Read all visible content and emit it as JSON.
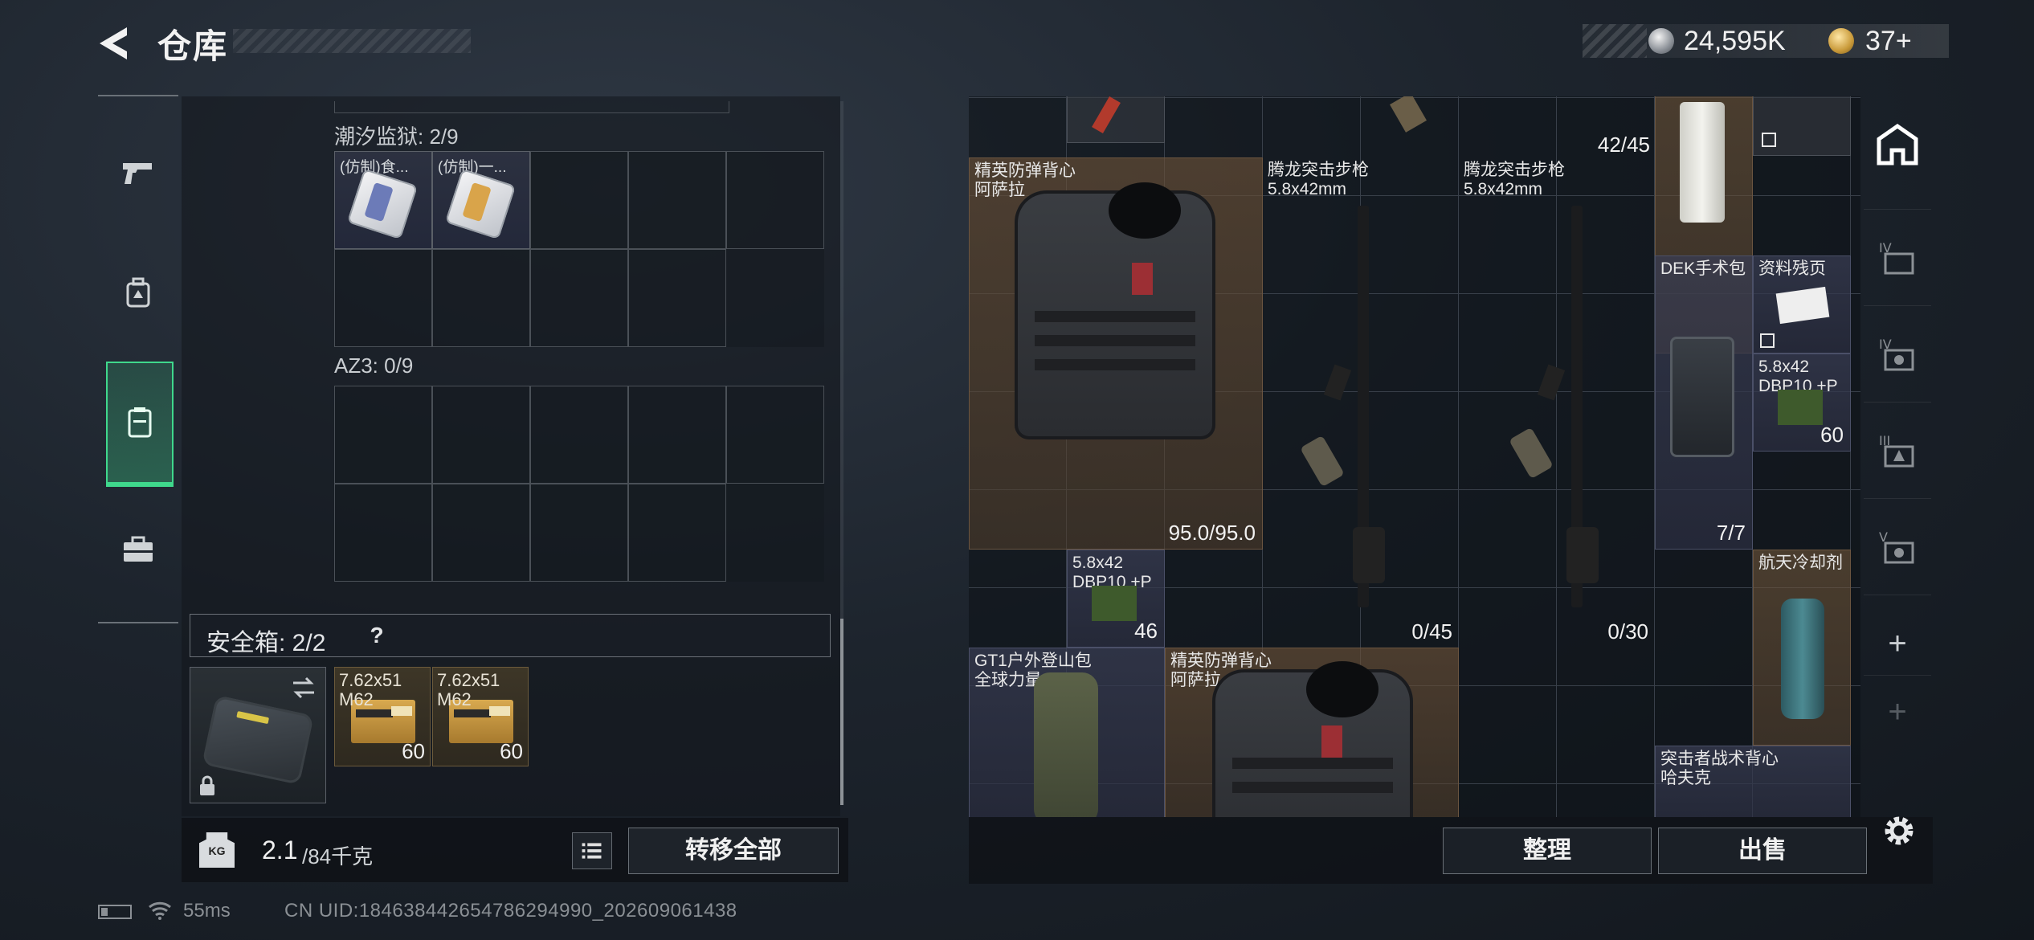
{
  "header": {
    "title": "仓库",
    "silver_amount": "24,595K",
    "gold_amount": "37+"
  },
  "left_panel": {
    "section_1_label": "潮汐监狱: 2/9",
    "section_1_items": [
      {
        "name": "(仿制)食...",
        "accent": "#6c7bb8"
      },
      {
        "name": "(仿制)一...",
        "accent": "#d9a44a"
      }
    ],
    "section_2_label": "AZ3: 0/9",
    "safe_box_label": "安全箱: 2/2",
    "safe_box_help": "?",
    "ammo": [
      {
        "name": "7.62x51\nM62",
        "count": "60"
      },
      {
        "name": "7.62x51\nM62",
        "count": "60"
      }
    ],
    "weight_current": "2.1",
    "weight_max": "/84千克",
    "weight_icon_text": "KG",
    "transfer_all_label": "转移全部"
  },
  "stash": {
    "top_count": "42/45",
    "items": [
      {
        "id": "vest1",
        "name": "精英防弹背心\n阿萨拉",
        "count": "95.0/95.0"
      },
      {
        "id": "rifle1",
        "name": "腾龙突击步枪\n5.8x42mm",
        "count": "0/45"
      },
      {
        "id": "rifle2",
        "name": "腾龙突击步枪\n5.8x42mm",
        "count": "0/30"
      },
      {
        "id": "surgical",
        "name": "DEK手术包",
        "count": "7/7"
      },
      {
        "id": "docs",
        "name": "资料残页",
        "count": ""
      },
      {
        "id": "ammo-r",
        "name": "5.8x42\nDBP10 +P",
        "count": "60"
      },
      {
        "id": "ammo-l",
        "name": "5.8x42\nDBP10 +P",
        "count": "46"
      },
      {
        "id": "coolant",
        "name": "航天冷却剂",
        "count": ""
      },
      {
        "id": "backpack",
        "name": "GT1户外登山包\n全球力量",
        "count": ""
      },
      {
        "id": "vest2",
        "name": "精英防弹背心\n阿萨拉",
        "count": ""
      },
      {
        "id": "rig",
        "name": "突击者战术背心\n哈夫克",
        "count": ""
      }
    ]
  },
  "right_rail": {
    "add_1": "+",
    "add_2": "+"
  },
  "buttons": {
    "sort": "整理",
    "sell": "出售"
  },
  "status": {
    "ping": "55ms",
    "uid": "CN UID:1846384426547862949​90_202609061438"
  }
}
